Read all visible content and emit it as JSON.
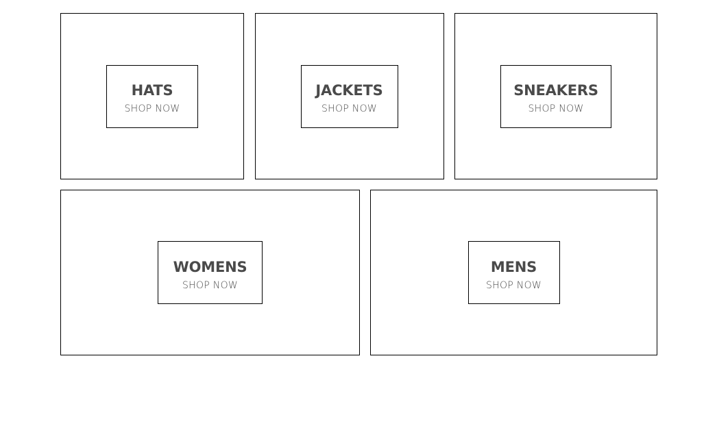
{
  "directory": {
    "categories": [
      {
        "title": "HATS",
        "subtitle": "SHOP NOW"
      },
      {
        "title": "JACKETS",
        "subtitle": "SHOP NOW"
      },
      {
        "title": "SNEAKERS",
        "subtitle": "SHOP NOW"
      },
      {
        "title": "WOMENS",
        "subtitle": "SHOP NOW"
      },
      {
        "title": "MENS",
        "subtitle": "SHOP NOW"
      }
    ]
  },
  "colors": {
    "border": "#000000",
    "text": "#4a4a4a",
    "background": "#ffffff"
  }
}
